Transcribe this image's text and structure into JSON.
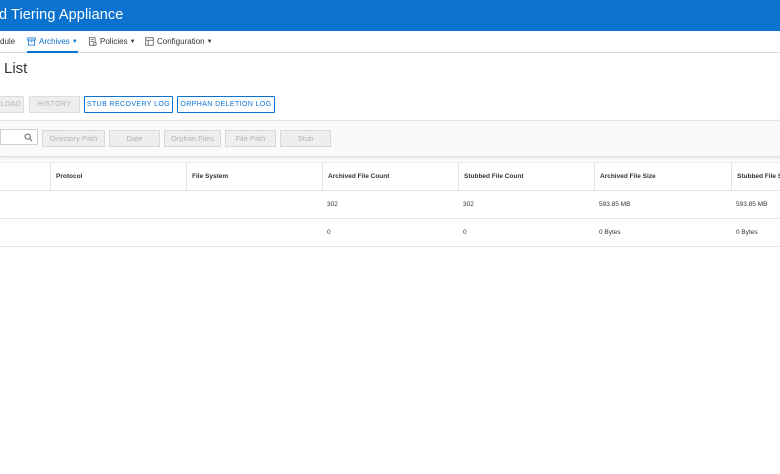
{
  "header": {
    "title": "d Tiering Appliance"
  },
  "nav": {
    "items": [
      {
        "label": "dule",
        "icon": "",
        "caret": false
      },
      {
        "label": "Archives",
        "icon": "archive-icon",
        "caret": true,
        "active": true
      },
      {
        "label": "Policies",
        "icon": "policy-document-icon",
        "caret": true
      },
      {
        "label": "Configuration",
        "icon": "configuration-icon",
        "caret": true
      }
    ]
  },
  "page": {
    "title": "List"
  },
  "toolbar": {
    "buttons": [
      {
        "label": "LOAD",
        "state": "disabled"
      },
      {
        "label": "HISTORY",
        "state": "disabled"
      },
      {
        "label": "STUB RECOVERY LOG",
        "state": "enabled"
      },
      {
        "label": "ORPHAN DELETION LOG",
        "state": "enabled"
      }
    ]
  },
  "filters": {
    "search_placeholder": "",
    "chips": [
      "Directory Path",
      "Date",
      "Orphan Files",
      "File Path",
      "Stub"
    ]
  },
  "table": {
    "columns": [
      "Protocol",
      "File System",
      "Archived File Count",
      "Stubbed File Count",
      "Archived File Size",
      "Stubbed File Siz"
    ],
    "rows": [
      {
        "protocol": "",
        "file_system": "",
        "archived_count": "302",
        "stubbed_count": "302",
        "archived_size": "593.85 MB",
        "stubbed_size": "593.85 MB"
      },
      {
        "protocol": "",
        "file_system": "",
        "archived_count": "0",
        "stubbed_count": "0",
        "archived_size": "0 Bytes",
        "stubbed_size": "0 Bytes"
      }
    ]
  },
  "colors": {
    "brand": "#0b72cf",
    "disabled_bg": "#eeeeee",
    "disabled_text": "#b3b3b3"
  }
}
